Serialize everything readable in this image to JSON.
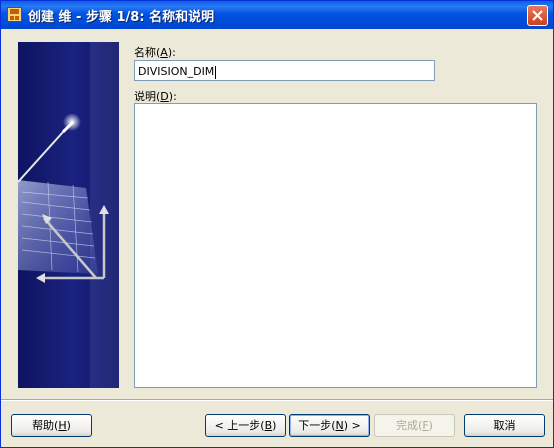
{
  "window": {
    "title": "创建 维 - 步骤 1/8: 名称和说明"
  },
  "form": {
    "name_label": "名称(",
    "name_key": "A",
    "name_label_end": "):",
    "name_value": "DIVISION_DIM",
    "desc_label": "说明(",
    "desc_key": "D",
    "desc_label_end": "):",
    "desc_value": ""
  },
  "buttons": {
    "help": {
      "label": "帮助(",
      "key": "H",
      "end": ")"
    },
    "back": {
      "label": "< 上一步(",
      "key": "B",
      "end": ")"
    },
    "next": {
      "label": "下一步(",
      "key": "N",
      "end": ") >"
    },
    "finish": {
      "label": "完成(",
      "key": "F",
      "end": ")"
    },
    "cancel": {
      "label": "取消"
    }
  },
  "colors": {
    "titlebar": "#0054E3",
    "side_panel": "#141A6A",
    "dialog_bg": "#ECE9D8"
  },
  "icons": {
    "app": "app-icon",
    "close": "close-icon",
    "wizard_art": "wizard-illustration"
  }
}
